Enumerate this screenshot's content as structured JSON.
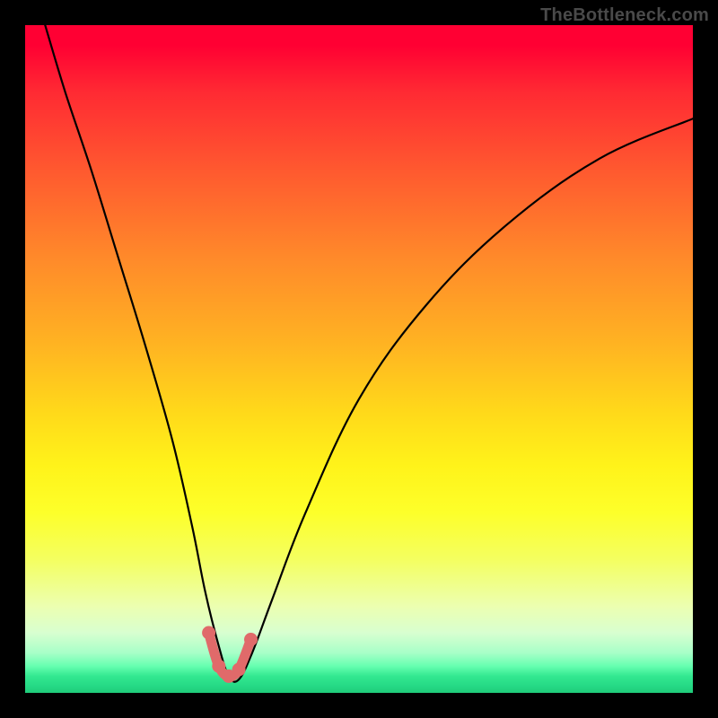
{
  "watermark": "TheBottleneck.com",
  "chart_data": {
    "type": "line",
    "title": "",
    "xlabel": "",
    "ylabel": "",
    "xlim": [
      0,
      100
    ],
    "ylim": [
      0,
      100
    ],
    "grid": false,
    "legend": false,
    "background_gradient": {
      "top_color": "#ff0033",
      "bottom_color": "#20cc7a",
      "description": "vertical heat gradient red→orange→yellow→green"
    },
    "series": [
      {
        "name": "bottleneck-curve",
        "color": "#000000",
        "x": [
          3,
          6,
          10,
          14,
          18,
          22,
          25,
          27,
          29,
          30.5,
          32,
          34,
          37,
          42,
          50,
          60,
          72,
          86,
          100
        ],
        "values": [
          100,
          90,
          78,
          65,
          52,
          38,
          25,
          15,
          7,
          2.5,
          2,
          6,
          14,
          27,
          44,
          58,
          70,
          80,
          86
        ]
      }
    ],
    "highlight": {
      "name": "salmon-minimum-marker",
      "color": "#e06a6a",
      "x": [
        27.5,
        29.0,
        30.5,
        32.0,
        33.8
      ],
      "values": [
        9.0,
        4.0,
        2.5,
        3.5,
        8.0
      ]
    }
  }
}
